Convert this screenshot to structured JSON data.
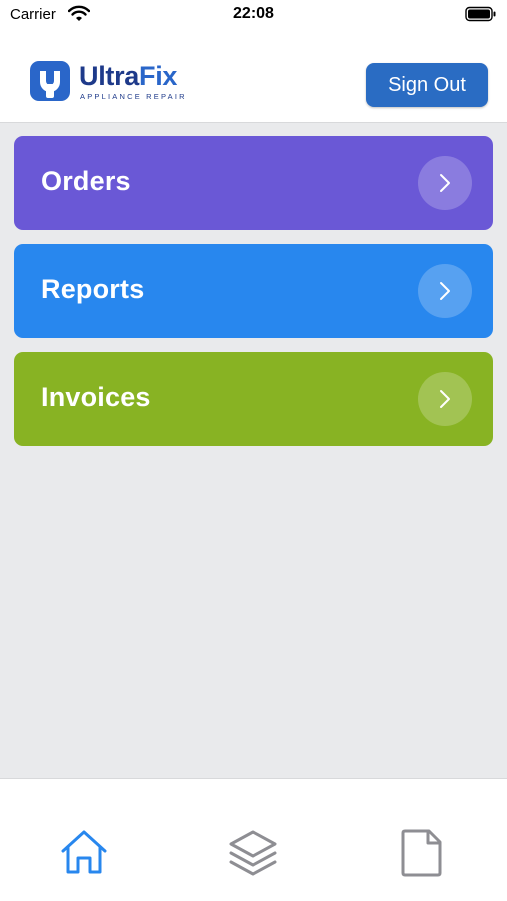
{
  "status_bar": {
    "carrier": "Carrier",
    "time": "22:08",
    "icons": [
      "wifi-icon",
      "battery-icon"
    ]
  },
  "header": {
    "logo": {
      "name_part1": "Ultra",
      "name_part2": "Fix",
      "tagline": "APPLIANCE REPAIR",
      "icon": "wrench-icon"
    },
    "sign_out_label": "Sign Out"
  },
  "menu": {
    "items": [
      {
        "label": "Orders",
        "color": "#6a58d6",
        "icon": "chevron-right-icon"
      },
      {
        "label": "Reports",
        "color": "#2887ee",
        "icon": "chevron-right-icon"
      },
      {
        "label": "Invoices",
        "color": "#88b323",
        "icon": "chevron-right-icon"
      }
    ]
  },
  "tab_bar": {
    "tabs": [
      {
        "icon": "home-icon",
        "active": true
      },
      {
        "icon": "layers-icon",
        "active": false
      },
      {
        "icon": "document-icon",
        "active": false
      }
    ],
    "active_color": "#2887ee",
    "inactive_color": "#8e8e93"
  }
}
